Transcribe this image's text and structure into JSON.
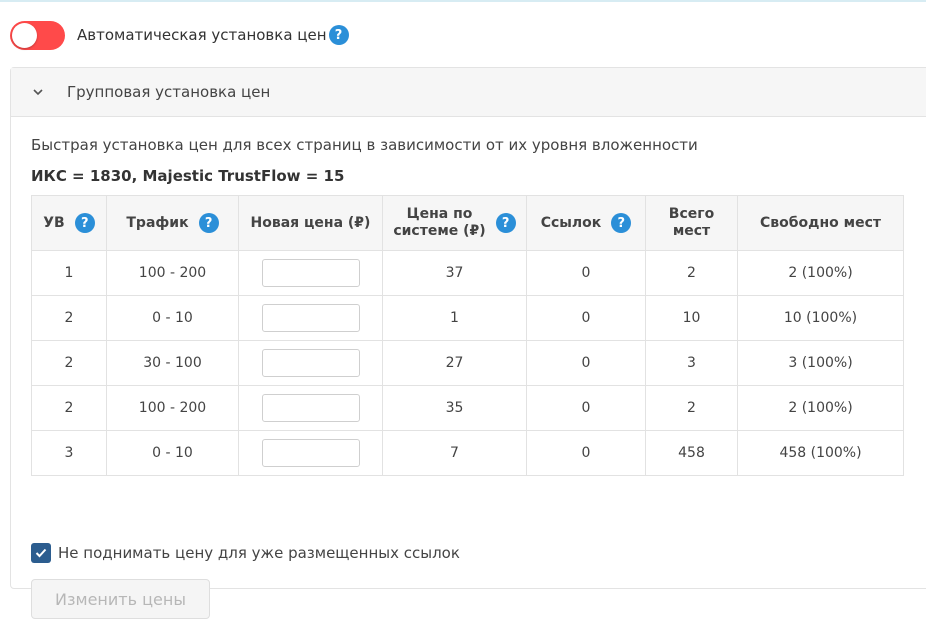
{
  "auto_pricing": {
    "label": "Автоматическая установка цен",
    "enabled": false,
    "toggle_color": "#ff4a4a"
  },
  "group_panel": {
    "title": "Групповая установка цен",
    "description": "Быстрая установка цен для всех страниц в зависимости от их уровня вложенности",
    "stats": "ИКС = 1830, Majestic TrustFlow = 15",
    "table": {
      "headers": {
        "level": "УВ",
        "traffic": "Трафик",
        "new_price": "Новая цена (₽)",
        "system_price_line1": "Цена по",
        "system_price_line2": "системе (₽)",
        "links": "Ссылок",
        "total_line1": "Всего",
        "total_line2": "мест",
        "free": "Свободно мест"
      },
      "rows": [
        {
          "level": "1",
          "traffic": "100 - 200",
          "new_price": "",
          "system_price": "37",
          "links": "0",
          "total": "2",
          "free": "2 (100%)"
        },
        {
          "level": "2",
          "traffic": "0 - 10",
          "new_price": "",
          "system_price": "1",
          "links": "0",
          "total": "10",
          "free": "10 (100%)"
        },
        {
          "level": "2",
          "traffic": "30 - 100",
          "new_price": "",
          "system_price": "27",
          "links": "0",
          "total": "3",
          "free": "3 (100%)"
        },
        {
          "level": "2",
          "traffic": "100 - 200",
          "new_price": "",
          "system_price": "35",
          "links": "0",
          "total": "2",
          "free": "2 (100%)"
        },
        {
          "level": "3",
          "traffic": "0 - 10",
          "new_price": "",
          "system_price": "7",
          "links": "0",
          "total": "458",
          "free": "458 (100%)"
        }
      ]
    },
    "keep_price_checkbox": {
      "label": "Не поднимать цену для уже размещенных ссылок",
      "checked": true
    },
    "submit_button": "Изменить цены"
  },
  "help_icon_glyph": "?",
  "colors": {
    "accent": "#2b8fd8",
    "checkbox": "#2c5d8f",
    "toggle_off": "#ff4a4a"
  }
}
